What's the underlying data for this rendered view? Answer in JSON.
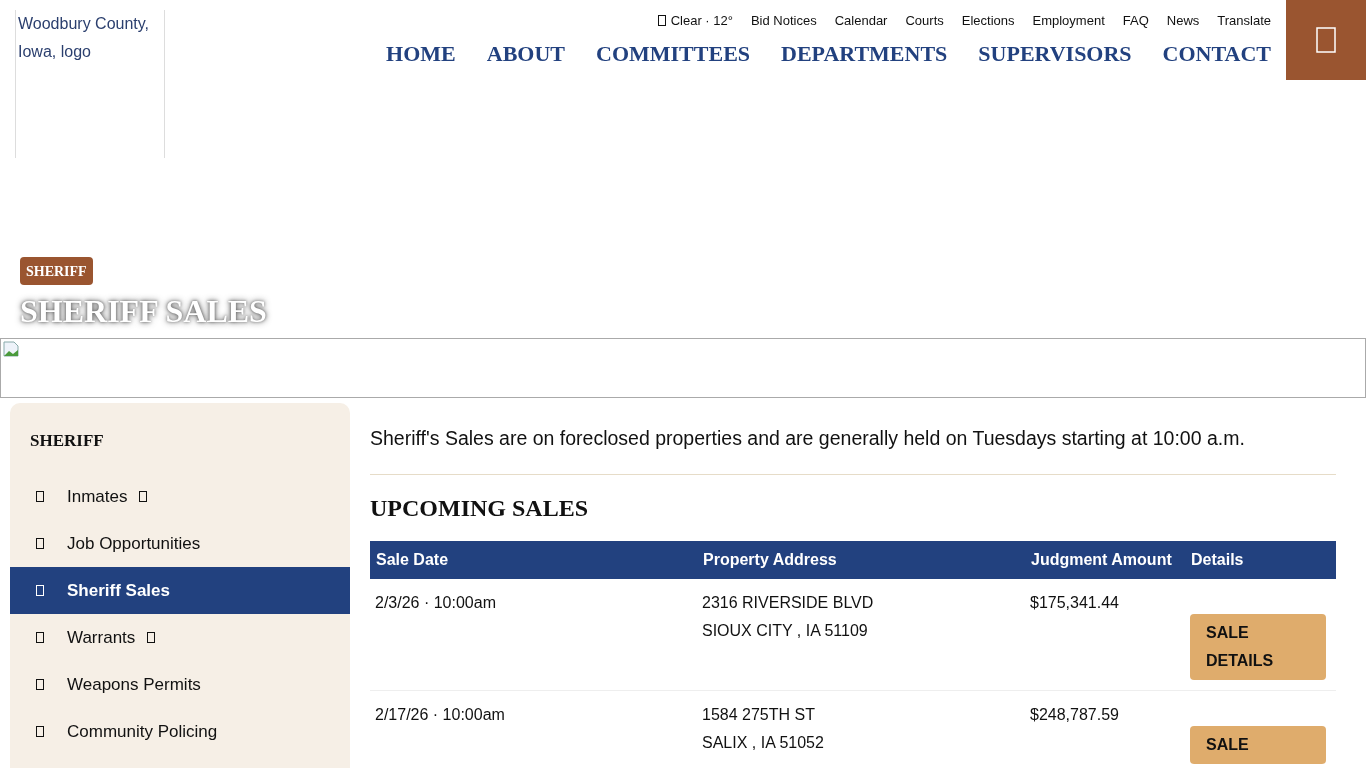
{
  "logo": {
    "alt_text": "Woodbury County, Iowa, logo"
  },
  "utility_links": [
    {
      "kind": "weather",
      "label": "Clear · 12°"
    },
    {
      "kind": "link",
      "label": "Bid Notices"
    },
    {
      "kind": "link",
      "label": "Calendar"
    },
    {
      "kind": "link",
      "label": "Courts"
    },
    {
      "kind": "link",
      "label": "Elections"
    },
    {
      "kind": "link",
      "label": "Employment"
    },
    {
      "kind": "link",
      "label": "FAQ"
    },
    {
      "kind": "link",
      "label": "News"
    },
    {
      "kind": "link",
      "label": "Translate"
    }
  ],
  "main_nav": [
    "HOME",
    "ABOUT",
    "COMMITTEES",
    "DEPARTMENTS",
    "SUPERVISORS",
    "CONTACT"
  ],
  "hero": {
    "category": "SHERIFF",
    "title": "SHERIFF SALES"
  },
  "sidebar": {
    "title": "SHERIFF",
    "items": [
      {
        "label": "Inmates",
        "selected": false,
        "expandable": true
      },
      {
        "label": "Job Opportunities",
        "selected": false,
        "expandable": false
      },
      {
        "label": "Sheriff Sales",
        "selected": true,
        "expandable": false
      },
      {
        "label": "Warrants",
        "selected": false,
        "expandable": true
      },
      {
        "label": "Weapons Permits",
        "selected": false,
        "expandable": false
      },
      {
        "label": "Community Policing",
        "selected": false,
        "expandable": false
      }
    ]
  },
  "intro": "Sheriff's Sales are on foreclosed properties and are generally held on Tuesdays starting at 10:00 a.m.",
  "section_title": "UPCOMING SALES",
  "table": {
    "columns": [
      "Sale Date",
      "Property Address",
      "Judgment Amount",
      "Details"
    ],
    "rows": [
      {
        "sale_date": "2/3/26 · 10:00am",
        "address_line_1": "2316 RIVERSIDE BLVD",
        "address_line_2": "SIOUX CITY , IA 51109",
        "judgment_amount": "$175,341.44",
        "details_button": [
          "SALE",
          "DETAILS"
        ]
      },
      {
        "sale_date": "2/17/26 · 10:00am",
        "address_line_1": "1584 275TH ST",
        "address_line_2": "SALIX , IA 51052",
        "judgment_amount": "$248,787.59",
        "details_button": [
          "SALE"
        ]
      }
    ]
  }
}
